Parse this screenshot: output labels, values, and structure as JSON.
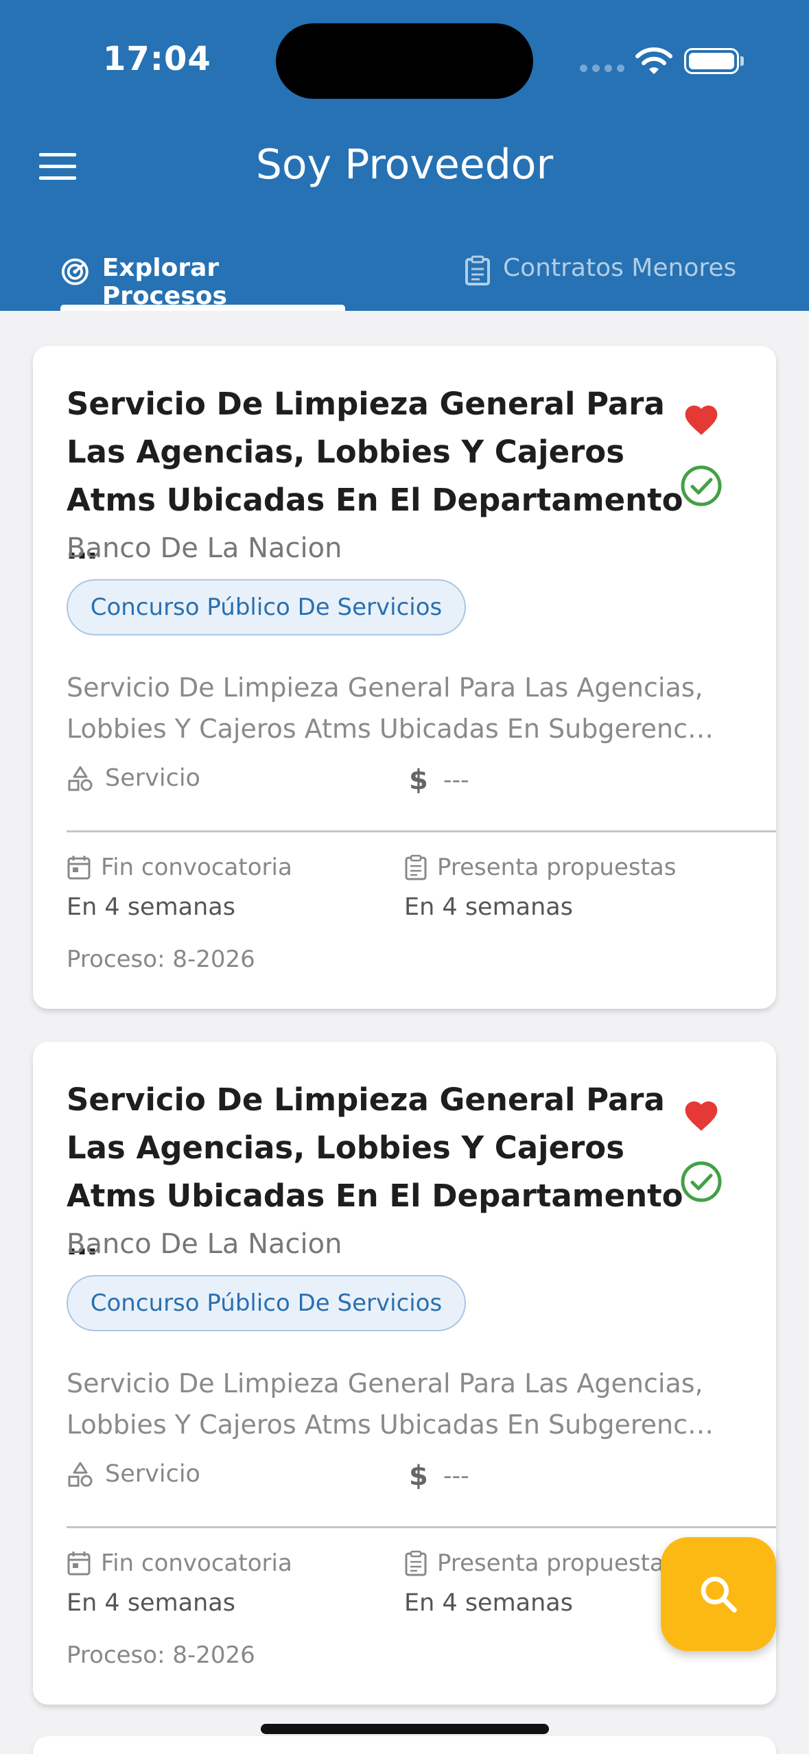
{
  "status_bar": {
    "time": "17:04"
  },
  "header": {
    "title": "Soy Proveedor"
  },
  "tabs": [
    {
      "label": "Explorar Procesos",
      "icon": "radar-icon",
      "active": true
    },
    {
      "label": "Contratos Menores",
      "icon": "clipboard-icon",
      "active": false
    }
  ],
  "cards": [
    {
      "title": "Servicio De Limpieza General Para Las Agencias, Lobbies Y Cajeros Atms Ubicadas En El Departamento …",
      "entity": "Banco De La Nacion",
      "badge": "Concurso Público De Servicios",
      "description": "Servicio De Limpieza General Para Las Agencias, Lobbies Y Cajeros Atms Ubicadas En Subgerenc…",
      "category": "Servicio",
      "amount": "---",
      "deadline_label": "Fin convocatoria",
      "deadline_value": "En 4 semanas",
      "proposal_label": "Presenta propuestas",
      "proposal_value": "En 4 semanas",
      "process": "Proceso: 8-2026",
      "favorite": true,
      "verified": true
    },
    {
      "title": "Servicio De Limpieza General Para Las Agencias, Lobbies Y Cajeros Atms Ubicadas En El Departamento …",
      "entity": "Banco De La Nacion",
      "badge": "Concurso Público De Servicios",
      "description": "Servicio De Limpieza General Para Las Agencias, Lobbies Y Cajeros Atms Ubicadas En Subgerenc…",
      "category": "Servicio",
      "amount": "---",
      "deadline_label": "Fin convocatoria",
      "deadline_value": "En 4 semanas",
      "proposal_label": "Presenta propuestas",
      "proposal_value": "En 4 semanas",
      "process": "Proceso: 8-2026",
      "favorite": true,
      "verified": true
    }
  ],
  "fab": {
    "icon": "search-icon"
  },
  "colors": {
    "header": "#2672b4",
    "fab": "#fdb913",
    "heart": "#e53935",
    "check": "#43a047"
  }
}
